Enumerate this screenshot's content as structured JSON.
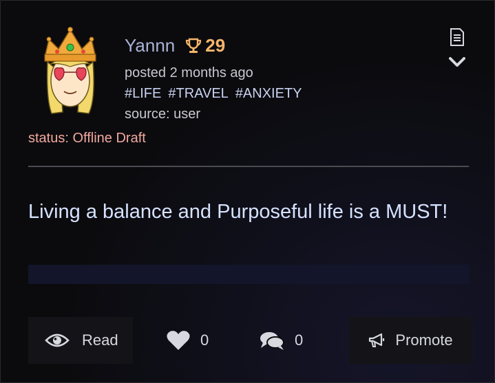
{
  "post": {
    "author": "Yannn",
    "trophy_count": "29",
    "posted": "posted 2 months ago",
    "tags": [
      "#LIFE",
      "#TRAVEL",
      "#ANXIETY"
    ],
    "source": "source: user",
    "status": "status: Offline Draft",
    "body": "Living a balance and Purposeful life is a MUST!"
  },
  "actions": {
    "read_label": "Read",
    "like_count": "0",
    "comment_count": "0",
    "promote_label": "Promote"
  },
  "icons": {
    "avatar": "avatar-queen-icon",
    "trophy": "trophy-icon",
    "document": "document-icon",
    "expand": "chevron-down-icon",
    "read": "eye-icon",
    "like": "heart-icon",
    "comment": "comments-icon",
    "promote": "megaphone-icon"
  },
  "colors": {
    "username": "#a9b3d6",
    "trophy": "#f5b66a",
    "status": "#f3a89e",
    "body_text": "#d6e2ff"
  }
}
